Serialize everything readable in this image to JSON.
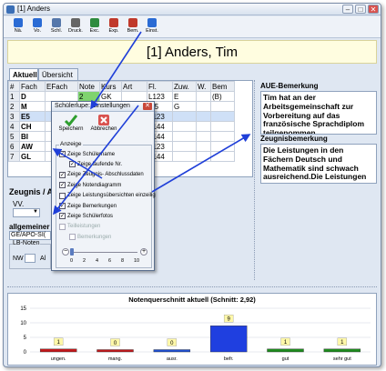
{
  "window": {
    "title": "[1] Anders",
    "controls": [
      "–",
      "□",
      "✕"
    ]
  },
  "toolbar": [
    {
      "label": "Nä.",
      "icon": "info-icon",
      "color": "#2a6bd4"
    },
    {
      "label": "Vo.",
      "icon": "info-icon",
      "color": "#2a6bd4"
    },
    {
      "label": "Schl.",
      "icon": "close-doc-icon",
      "color": "#5577aa"
    },
    {
      "label": "Druck.",
      "icon": "print-icon",
      "color": "#666666"
    },
    {
      "label": "Exc.",
      "icon": "excel-icon",
      "color": "#2e8b3e"
    },
    {
      "label": "Exp.",
      "icon": "export-icon",
      "color": "#c0392b"
    },
    {
      "label": "Bem.",
      "icon": "note-icon",
      "color": "#c0392b"
    },
    {
      "label": "Einst.",
      "icon": "settings-icon",
      "color": "#2a6bd4"
    }
  ],
  "banner": {
    "name": "[1] Anders, Tim"
  },
  "tabs": [
    "Aktuell",
    "Übersicht"
  ],
  "grid": {
    "headers": [
      "#",
      "Fach",
      "EFach",
      "Note",
      "Kurs",
      "Art",
      "Fl.",
      "Zuw.",
      "W.",
      "Bem"
    ],
    "rows": [
      [
        "1",
        "D",
        "",
        "2",
        "GK",
        "",
        "L123",
        "E",
        "",
        "(B)"
      ],
      [
        "2",
        "M",
        "",
        "",
        "",
        "",
        "I35",
        "G",
        "",
        ""
      ],
      [
        "3",
        "E5",
        "",
        "",
        "",
        "",
        "L123",
        "",
        "",
        ""
      ],
      [
        "4",
        "CH",
        "",
        "",
        "",
        "",
        "L144",
        "",
        "",
        ""
      ],
      [
        "5",
        "BI",
        "",
        "",
        "",
        "",
        "L144",
        "",
        "",
        ""
      ],
      [
        "6",
        "AW",
        "",
        "",
        "",
        "",
        "L123",
        "",
        "",
        ""
      ],
      [
        "7",
        "GL",
        "",
        "",
        "",
        "",
        "L144",
        "",
        "",
        ""
      ]
    ]
  },
  "lower": {
    "zeugnis_label": "Zeugnis / A",
    "vv_label": "VV.",
    "t_label": "T",
    "allgemein_label": "allgemeiner",
    "allgemein_value": "GE/APO-SI(",
    "lb_noten_label": "LB-Noten",
    "nw_label": "NW",
    "al_label": "Al"
  },
  "aue": {
    "label": "AUE-Bemerkung",
    "text": "Tim hat an der Arbeitsgemeinschaft zur Vorbereitung auf das französische Sprachdiplom teilgenommen."
  },
  "zeugnis_bem": {
    "label": "Zeugnisbemerkung",
    "text": "Die Leistungen in den Fächern  Deutsch und Mathematik sind schwach ausreichend.Die Leistungen"
  },
  "dialog": {
    "title": "Schülerlupe: Einstellungen",
    "save_label": "Speichern",
    "cancel_label": "Abbrechen",
    "group_label": "Anzeige",
    "options": [
      {
        "label": "Zeige Schülername",
        "checked": true,
        "indent": false,
        "disabled": false
      },
      {
        "label": "Zeige laufende Nr.",
        "checked": true,
        "indent": true,
        "disabled": false
      },
      {
        "label": "Zeige Zeugnis- Abschlussdaten",
        "checked": true,
        "indent": false,
        "disabled": false
      },
      {
        "label": "Zeige Notendiagramm",
        "checked": true,
        "indent": false,
        "disabled": false
      },
      {
        "label": "Zeige Leistungsübersichten einzeilig",
        "checked": false,
        "indent": false,
        "disabled": false
      },
      {
        "label": "Zeige Bemerkungen",
        "checked": true,
        "indent": false,
        "disabled": false
      },
      {
        "label": "Zeige Schülerfotos",
        "checked": true,
        "indent": false,
        "disabled": false
      },
      {
        "label": "Teilleistungen",
        "checked": false,
        "indent": false,
        "disabled": true
      },
      {
        "label": "Bemerkungen",
        "checked": false,
        "indent": true,
        "disabled": true
      }
    ],
    "slider": {
      "ticks": [
        "0",
        "2",
        "4",
        "6",
        "8",
        "10"
      ],
      "value": 0
    }
  },
  "chart_data": {
    "type": "bar",
    "title": "Notenquerschnitt aktuell (Schnitt: 2,92)",
    "categories": [
      "ungen.",
      "mang.",
      "ausr.",
      "befr.",
      "gut",
      "sehr gut"
    ],
    "values": [
      1,
      0,
      0,
      9,
      1,
      1
    ],
    "colors": [
      "#c0181b",
      "#c0181b",
      "#1f4fd1",
      "#1f3fe0",
      "#1e8a1e",
      "#1e8a1e"
    ],
    "ylim": [
      0,
      15
    ],
    "yticks": [
      "0",
      "5",
      "10",
      "15"
    ]
  }
}
